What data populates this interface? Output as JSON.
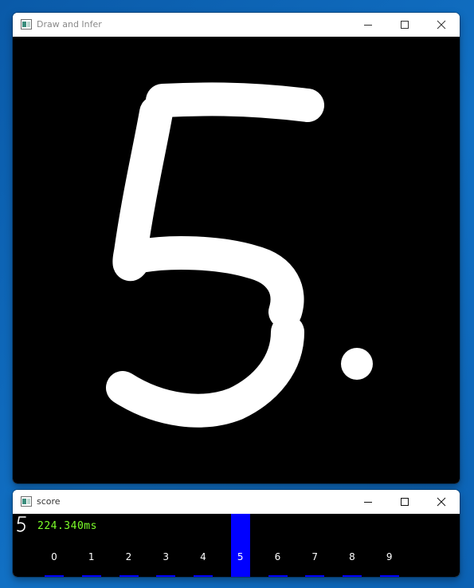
{
  "windows": {
    "draw": {
      "title": "Draw and Infer",
      "drawn_digit": "5",
      "drawn_mark": "."
    },
    "score": {
      "title": "score",
      "predicted_digit": "5",
      "inference_time": "224.340ms",
      "classes": [
        "0",
        "1",
        "2",
        "3",
        "4",
        "5",
        "6",
        "7",
        "8",
        "9"
      ],
      "scores": [
        0.02,
        0.02,
        0.02,
        0.02,
        0.02,
        1.0,
        0.02,
        0.02,
        0.02,
        0.02
      ],
      "bar_color": "#0000ff",
      "timing_color": "#7cff2a"
    }
  },
  "desktop": {
    "background_color": "#0f63b3"
  }
}
